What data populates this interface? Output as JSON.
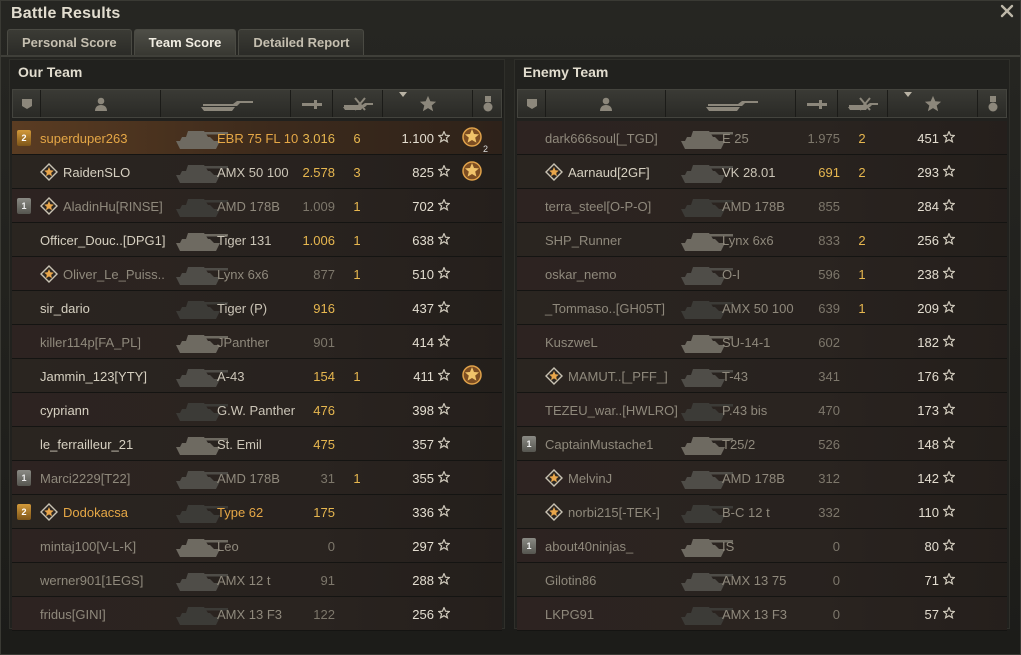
{
  "window": {
    "title": "Battle Results"
  },
  "tabs": [
    {
      "label": "Personal Score",
      "active": false
    },
    {
      "label": "Team Score",
      "active": true
    },
    {
      "label": "Detailed Report",
      "active": false
    }
  ],
  "columns": [
    "platoon-icon",
    "player-icon",
    "vehicle-icon",
    "damage-icon",
    "kills-icon",
    "xp-icon",
    "medal-icon"
  ],
  "our_team": {
    "title": "Our Team",
    "rows": [
      {
        "platoon": "2",
        "mark": false,
        "name": "superduper263",
        "name_style": "gold",
        "tank": "EBR 75 FL 10",
        "tank_style": "gold",
        "damage": "3.016",
        "kills": "6",
        "xp": "1.100",
        "medal": "2",
        "highlight": true
      },
      {
        "platoon": "",
        "mark": true,
        "name": "RaidenSLO",
        "name_style": "normal",
        "tank": "AMX 50 100",
        "tank_style": "normal",
        "damage": "2.578",
        "kills": "3",
        "xp": "825",
        "medal": "1"
      },
      {
        "platoon": "1",
        "mark": true,
        "name": "AladinHu[RINSE]",
        "name_style": "dim",
        "tank": "AMD 178B",
        "tank_style": "dim",
        "damage": "1.009",
        "kills": "1",
        "xp": "702",
        "medal": ""
      },
      {
        "platoon": "",
        "mark": false,
        "name": "Officer_Douc..[DPG1]",
        "name_style": "normal",
        "tank": "Tiger 131",
        "tank_style": "normal",
        "damage": "1.006",
        "kills": "1",
        "xp": "638",
        "medal": ""
      },
      {
        "platoon": "",
        "mark": true,
        "name": "Oliver_Le_Puiss..",
        "name_style": "dim",
        "tank": "Lynx 6x6",
        "tank_style": "dim",
        "damage": "877",
        "kills": "1",
        "xp": "510",
        "medal": ""
      },
      {
        "platoon": "",
        "mark": false,
        "name": "sir_dario",
        "name_style": "normal",
        "tank": "Tiger (P)",
        "tank_style": "normal",
        "damage": "916",
        "kills": "",
        "xp": "437",
        "medal": ""
      },
      {
        "platoon": "",
        "mark": false,
        "name": "killer114p[FA_PL]",
        "name_style": "dim",
        "tank": "JPanther",
        "tank_style": "dim",
        "damage": "901",
        "kills": "",
        "xp": "414",
        "medal": ""
      },
      {
        "platoon": "",
        "mark": false,
        "name": "Jammin_123[YTY]",
        "name_style": "normal",
        "tank": "A-43",
        "tank_style": "normal",
        "damage": "154",
        "kills": "1",
        "xp": "411",
        "medal": "1"
      },
      {
        "platoon": "",
        "mark": false,
        "name": "cypriann",
        "name_style": "normal",
        "tank": "G.W. Panther",
        "tank_style": "normal",
        "damage": "476",
        "kills": "",
        "xp": "398",
        "medal": ""
      },
      {
        "platoon": "",
        "mark": false,
        "name": "le_ferrailleur_21",
        "name_style": "normal",
        "tank": "St. Emil",
        "tank_style": "normal",
        "damage": "475",
        "kills": "",
        "xp": "357",
        "medal": ""
      },
      {
        "platoon": "1",
        "mark": false,
        "name": "Marci2229[T22]",
        "name_style": "dim",
        "tank": "AMD 178B",
        "tank_style": "dim",
        "damage": "31",
        "kills": "1",
        "xp": "355",
        "medal": ""
      },
      {
        "platoon": "2",
        "mark": true,
        "name": "Dodokacsa",
        "name_style": "gold",
        "tank": "Type 62",
        "tank_style": "gold",
        "damage": "175",
        "kills": "",
        "xp": "336",
        "medal": ""
      },
      {
        "platoon": "",
        "mark": false,
        "name": "mintaj100[V-L-K]",
        "name_style": "dim",
        "tank": "Leo",
        "tank_style": "dim",
        "damage": "0",
        "kills": "",
        "xp": "297",
        "medal": ""
      },
      {
        "platoon": "",
        "mark": false,
        "name": "werner901[1EGS]",
        "name_style": "dim",
        "tank": "AMX 12 t",
        "tank_style": "dim",
        "damage": "91",
        "kills": "",
        "xp": "288",
        "medal": ""
      },
      {
        "platoon": "",
        "mark": false,
        "name": "fridus[GINI]",
        "name_style": "dim",
        "tank": "AMX 13 F3",
        "tank_style": "dim",
        "damage": "122",
        "kills": "",
        "xp": "256",
        "medal": ""
      }
    ]
  },
  "enemy_team": {
    "title": "Enemy Team",
    "rows": [
      {
        "platoon": "",
        "mark": false,
        "name": "dark666soul[_TGD]",
        "name_style": "dim",
        "tank": "E 25",
        "tank_style": "dim",
        "damage": "1.975",
        "kills": "2",
        "xp": "451",
        "medal": ""
      },
      {
        "platoon": "",
        "mark": true,
        "name": "Aarnaud[2GF]",
        "name_style": "normal",
        "tank": "VK 28.01",
        "tank_style": "normal",
        "damage": "691",
        "kills": "2",
        "xp": "293",
        "medal": ""
      },
      {
        "platoon": "",
        "mark": false,
        "name": "terra_steel[O-P-O]",
        "name_style": "dim",
        "tank": "AMD 178B",
        "tank_style": "dim",
        "damage": "855",
        "kills": "",
        "xp": "284",
        "medal": ""
      },
      {
        "platoon": "",
        "mark": false,
        "name": "SHP_Runner",
        "name_style": "dim",
        "tank": "Lynx 6x6",
        "tank_style": "dim",
        "damage": "833",
        "kills": "2",
        "xp": "256",
        "medal": ""
      },
      {
        "platoon": "",
        "mark": false,
        "name": "oskar_nemo",
        "name_style": "dim",
        "tank": "O-I",
        "tank_style": "dim",
        "damage": "596",
        "kills": "1",
        "xp": "238",
        "medal": ""
      },
      {
        "platoon": "",
        "mark": false,
        "name": "_Tommaso..[GH05T]",
        "name_style": "dim",
        "tank": "AMX 50 100",
        "tank_style": "dim",
        "damage": "639",
        "kills": "1",
        "xp": "209",
        "medal": ""
      },
      {
        "platoon": "",
        "mark": false,
        "name": "KuszweL",
        "name_style": "dim",
        "tank": "SU-14-1",
        "tank_style": "dim",
        "damage": "602",
        "kills": "",
        "xp": "182",
        "medal": ""
      },
      {
        "platoon": "",
        "mark": true,
        "name": "MAMUT..[_PFF_]",
        "name_style": "dim",
        "tank": "T-43",
        "tank_style": "dim",
        "damage": "341",
        "kills": "",
        "xp": "176",
        "medal": ""
      },
      {
        "platoon": "",
        "mark": false,
        "name": "TEZEU_war..[HWLRO]",
        "name_style": "dim",
        "tank": "P.43 bis",
        "tank_style": "dim",
        "damage": "470",
        "kills": "",
        "xp": "173",
        "medal": ""
      },
      {
        "platoon": "1",
        "mark": false,
        "name": "CaptainMustache1",
        "name_style": "dim",
        "tank": "T25/2",
        "tank_style": "dim",
        "damage": "526",
        "kills": "",
        "xp": "148",
        "medal": ""
      },
      {
        "platoon": "",
        "mark": true,
        "name": "MelvinJ",
        "name_style": "dim",
        "tank": "AMD 178B",
        "tank_style": "dim",
        "damage": "312",
        "kills": "",
        "xp": "142",
        "medal": ""
      },
      {
        "platoon": "",
        "mark": true,
        "name": "norbi215[-TEK-]",
        "name_style": "dim",
        "tank": "B-C 12 t",
        "tank_style": "dim",
        "damage": "332",
        "kills": "",
        "xp": "110",
        "medal": ""
      },
      {
        "platoon": "1",
        "mark": false,
        "name": "about40ninjas_",
        "name_style": "dim",
        "tank": "IS",
        "tank_style": "dim",
        "damage": "0",
        "kills": "",
        "xp": "80",
        "medal": ""
      },
      {
        "platoon": "",
        "mark": false,
        "name": "Gilotin86",
        "name_style": "dim",
        "tank": "AMX 13 75",
        "tank_style": "dim",
        "damage": "0",
        "kills": "",
        "xp": "71",
        "medal": ""
      },
      {
        "platoon": "",
        "mark": false,
        "name": "LKPG91",
        "name_style": "dim",
        "tank": "AMX 13 F3",
        "tank_style": "dim",
        "damage": "0",
        "kills": "",
        "xp": "57",
        "medal": ""
      }
    ]
  }
}
